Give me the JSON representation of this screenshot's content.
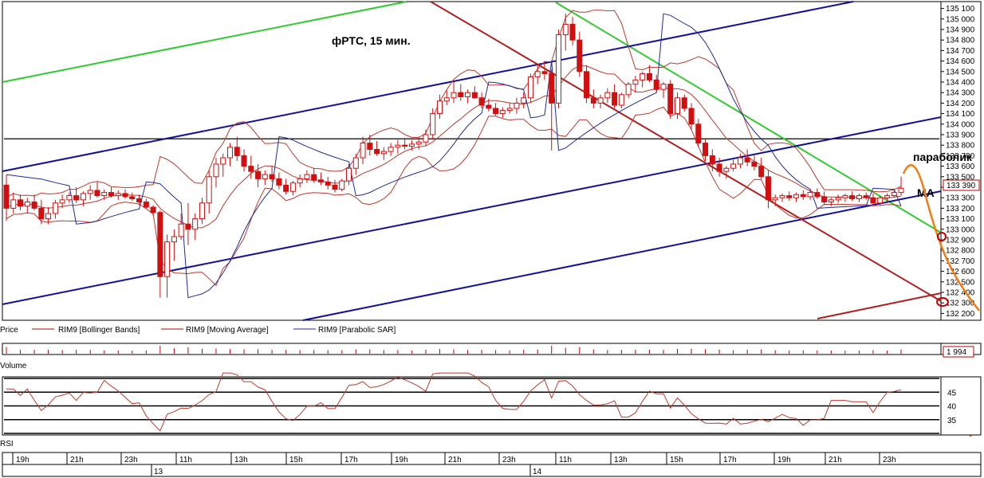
{
  "chart_data": {
    "type": "candlestick",
    "title": "фРТС,  15 мин.",
    "annotations": {
      "parabolic": "параболик",
      "ma": "МА"
    },
    "legend": {
      "price": "Price",
      "bollinger": "RIM9 [Bollinger Bands]",
      "ma": "RIM9 [Moving Average]",
      "sar": "RIM9 [Parabolic SAR]"
    },
    "y_ticks": [
      132200,
      132300,
      132400,
      132500,
      132600,
      132700,
      132800,
      132900,
      133000,
      133100,
      133200,
      133300,
      133400,
      133500,
      133600,
      133700,
      133800,
      133900,
      134000,
      134100,
      134200,
      134300,
      134400,
      134500,
      134600,
      134700,
      134800,
      134900,
      135000,
      135100
    ],
    "y_tick_labels": [
      "132 200",
      "132 300",
      "132 400",
      "132 500",
      "132 600",
      "132 700",
      "132 800",
      "132 900",
      "133 000",
      "133 100",
      "133 200",
      "133 300",
      "133 400",
      "133 500",
      "133 600",
      "133 700",
      "133 800",
      "133 900",
      "134 000",
      "134 100",
      "134 200",
      "134 300",
      "134 400",
      "134 500",
      "134 600",
      "134 700",
      "134 800",
      "134 900",
      "135 000",
      "135 100"
    ],
    "ylim": [
      132150,
      135150
    ],
    "last_price_label": "133 390",
    "candles": [
      [
        133420,
        133520,
        133080,
        133200
      ],
      [
        133200,
        133350,
        133150,
        133280
      ],
      [
        133280,
        133330,
        133180,
        133220
      ],
      [
        133220,
        133300,
        133150,
        133260
      ],
      [
        133260,
        133330,
        133180,
        133200
      ],
      [
        133200,
        133280,
        133050,
        133100
      ],
      [
        133100,
        133210,
        133050,
        133150
      ],
      [
        133150,
        133280,
        133100,
        133250
      ],
      [
        133250,
        133330,
        133200,
        133280
      ],
      [
        133280,
        133350,
        133250,
        133320
      ],
      [
        133320,
        133400,
        133250,
        133280
      ],
      [
        133280,
        133360,
        133220,
        133340
      ],
      [
        133340,
        133420,
        133280,
        133370
      ],
      [
        133370,
        133450,
        133300,
        133320
      ],
      [
        133320,
        133380,
        133280,
        133350
      ],
      [
        133350,
        133400,
        133300,
        133320
      ],
      [
        133320,
        133370,
        133280,
        133340
      ],
      [
        133340,
        133380,
        133290,
        133310
      ],
      [
        133310,
        133350,
        133270,
        133290
      ],
      [
        133290,
        133330,
        133230,
        133260
      ],
      [
        133260,
        133290,
        133200,
        133210
      ],
      [
        133210,
        133230,
        133130,
        133160
      ],
      [
        133160,
        133180,
        132350,
        132550
      ],
      [
        132550,
        132950,
        132350,
        132880
      ],
      [
        132880,
        133000,
        132700,
        132930
      ],
      [
        132930,
        133150,
        132900,
        133050
      ],
      [
        133050,
        133250,
        132850,
        133000
      ],
      [
        133000,
        133150,
        132900,
        133100
      ],
      [
        133100,
        133300,
        133050,
        133250
      ],
      [
        133250,
        133560,
        133150,
        133500
      ],
      [
        133500,
        133680,
        133400,
        133620
      ],
      [
        133620,
        133720,
        133500,
        133680
      ],
      [
        133680,
        133820,
        133600,
        133780
      ],
      [
        133780,
        133880,
        133650,
        133700
      ],
      [
        133700,
        133760,
        133550,
        133600
      ],
      [
        133600,
        133700,
        133480,
        133550
      ],
      [
        133550,
        133620,
        133400,
        133480
      ],
      [
        133480,
        133560,
        133420,
        133520
      ],
      [
        133520,
        133600,
        133450,
        133480
      ],
      [
        133480,
        133540,
        133380,
        133420
      ],
      [
        133420,
        133480,
        133330,
        133360
      ],
      [
        133360,
        133460,
        133320,
        133440
      ],
      [
        133440,
        133520,
        133400,
        133480
      ],
      [
        133480,
        133560,
        133440,
        133520
      ],
      [
        133520,
        133580,
        133440,
        133470
      ],
      [
        133470,
        133540,
        133420,
        133450
      ],
      [
        133450,
        133500,
        133380,
        133420
      ],
      [
        133420,
        133470,
        133350,
        133380
      ],
      [
        133380,
        133480,
        133360,
        133460
      ],
      [
        133460,
        133620,
        133420,
        133580
      ],
      [
        133580,
        133720,
        133520,
        133680
      ],
      [
        133680,
        133880,
        133620,
        133820
      ],
      [
        133820,
        133900,
        133700,
        133760
      ],
      [
        133760,
        133840,
        133700,
        133720
      ],
      [
        133720,
        133780,
        133660,
        133740
      ],
      [
        133740,
        133820,
        133700,
        133780
      ],
      [
        133780,
        133850,
        133720,
        133800
      ],
      [
        133800,
        133870,
        133760,
        133790
      ],
      [
        133790,
        133850,
        133750,
        133810
      ],
      [
        133810,
        133880,
        133760,
        133830
      ],
      [
        133830,
        133950,
        133790,
        133900
      ],
      [
        133900,
        134150,
        133850,
        134100
      ],
      [
        134100,
        134280,
        134050,
        134220
      ],
      [
        134220,
        134320,
        134180,
        134250
      ],
      [
        134250,
        134400,
        134200,
        134300
      ],
      [
        134300,
        134380,
        134220,
        134260
      ],
      [
        134260,
        134330,
        134200,
        134300
      ],
      [
        134300,
        134360,
        134240,
        134250
      ],
      [
        134250,
        134300,
        134150,
        134180
      ],
      [
        134180,
        134240,
        134120,
        134150
      ],
      [
        134150,
        134200,
        134080,
        134100
      ],
      [
        134100,
        134160,
        134060,
        134130
      ],
      [
        134130,
        134200,
        134100,
        134150
      ],
      [
        134150,
        134250,
        134100,
        134200
      ],
      [
        134200,
        134300,
        134150,
        134250
      ],
      [
        134250,
        134480,
        134200,
        134450
      ],
      [
        134450,
        134560,
        134380,
        134500
      ],
      [
        134500,
        134600,
        134420,
        134480
      ],
      [
        134480,
        134520,
        133750,
        134200
      ],
      [
        134200,
        134900,
        134150,
        134850
      ],
      [
        134850,
        135050,
        134700,
        134950
      ],
      [
        134950,
        135020,
        134750,
        134800
      ],
      [
        134800,
        134880,
        134450,
        134500
      ],
      [
        134500,
        134560,
        134200,
        134250
      ],
      [
        134250,
        134330,
        134150,
        134200
      ],
      [
        134200,
        134280,
        134150,
        134250
      ],
      [
        134250,
        134340,
        134200,
        134300
      ],
      [
        134300,
        134380,
        134150,
        134180
      ],
      [
        134180,
        134300,
        134150,
        134280
      ],
      [
        134280,
        134400,
        134250,
        134380
      ],
      [
        134380,
        134460,
        134300,
        134420
      ],
      [
        134420,
        134500,
        134350,
        134480
      ],
      [
        134480,
        134560,
        134400,
        134420
      ],
      [
        134420,
        134470,
        134300,
        134330
      ],
      [
        134330,
        134400,
        134250,
        134380
      ],
      [
        134380,
        134420,
        134050,
        134100
      ],
      [
        134100,
        134300,
        134050,
        134250
      ],
      [
        134250,
        134280,
        134120,
        134150
      ],
      [
        134150,
        134200,
        133950,
        134000
      ],
      [
        134000,
        134050,
        133780,
        133820
      ],
      [
        133820,
        133860,
        133650,
        133700
      ],
      [
        133700,
        133760,
        133550,
        133620
      ],
      [
        133620,
        133680,
        133500,
        133550
      ],
      [
        133550,
        133600,
        133480,
        133580
      ],
      [
        133580,
        133660,
        133550,
        133620
      ],
      [
        133620,
        133720,
        133580,
        133680
      ],
      [
        133680,
        133760,
        133600,
        133640
      ],
      [
        133640,
        133700,
        133560,
        133600
      ],
      [
        133600,
        133680,
        133480,
        133500
      ],
      [
        133500,
        133560,
        133200,
        133280
      ],
      [
        133280,
        133330,
        133220,
        133300
      ],
      [
        133300,
        133340,
        133260,
        133320
      ],
      [
        133320,
        133360,
        133270,
        133300
      ],
      [
        133300,
        133350,
        133260,
        133330
      ],
      [
        133330,
        133370,
        133280,
        133310
      ],
      [
        133310,
        133380,
        133280,
        133350
      ],
      [
        133350,
        133390,
        133290,
        133310
      ],
      [
        133310,
        133360,
        133230,
        133260
      ],
      [
        133260,
        133300,
        133220,
        133280
      ],
      [
        133280,
        133330,
        133250,
        133300
      ],
      [
        133300,
        133340,
        133260,
        133320
      ],
      [
        133320,
        133360,
        133270,
        133290
      ],
      [
        133290,
        133340,
        133260,
        133320
      ],
      [
        133320,
        133350,
        133280,
        133300
      ],
      [
        133300,
        133340,
        133220,
        133250
      ],
      [
        133250,
        133320,
        133230,
        133300
      ],
      [
        133300,
        133340,
        133270,
        133320
      ],
      [
        133320,
        133370,
        133300,
        133350
      ],
      [
        133350,
        133500,
        133320,
        133390
      ]
    ],
    "volume_label": "1 994",
    "rsi": {
      "levels": [
        30,
        35,
        40,
        45,
        50
      ],
      "tick_labels": [
        "45",
        "40",
        "35"
      ],
      "ylim": [
        30,
        50
      ]
    },
    "x_time_labels": [
      "19h",
      "21h",
      "23h",
      "11h",
      "13h",
      "15h",
      "17h",
      "19h",
      "21h",
      "23h",
      "11h",
      "13h",
      "15h",
      "17h",
      "19h",
      "21h",
      "23h"
    ],
    "x_date_labels": [
      "13",
      "14"
    ],
    "panel_labels": {
      "volume": "Volume",
      "rsi": "RSI"
    }
  }
}
